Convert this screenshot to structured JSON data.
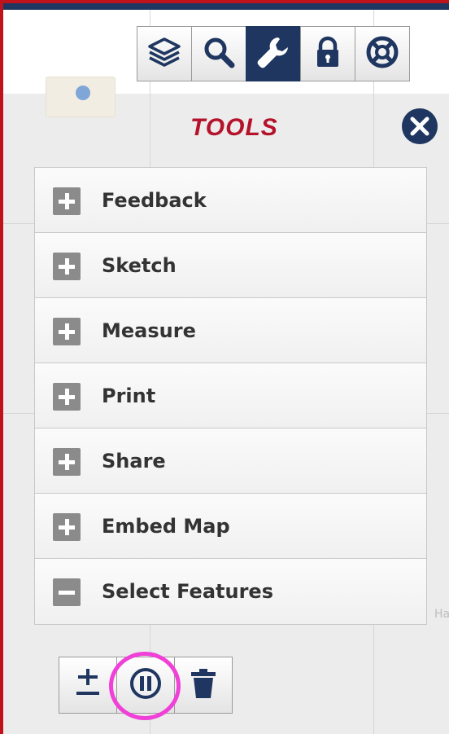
{
  "colors": {
    "accent_navy": "#1f3660",
    "title_red": "#b5132b",
    "frame_red": "#c0121b",
    "highlight_magenta": "#f040d8"
  },
  "map": {
    "partial_label": "Ha"
  },
  "toolbar": {
    "buttons": [
      {
        "icon": "layers-icon",
        "active": false
      },
      {
        "icon": "search-icon",
        "active": false
      },
      {
        "icon": "wrench-icon",
        "active": true
      },
      {
        "icon": "lock-icon",
        "active": false
      },
      {
        "icon": "lifebuoy-icon",
        "active": false
      }
    ]
  },
  "panel": {
    "title": "TOOLS",
    "close_icon": "close-icon",
    "items": [
      {
        "label": "Feedback",
        "state": "collapsed"
      },
      {
        "label": "Sketch",
        "state": "collapsed"
      },
      {
        "label": "Measure",
        "state": "collapsed"
      },
      {
        "label": "Print",
        "state": "collapsed"
      },
      {
        "label": "Share",
        "state": "collapsed"
      },
      {
        "label": "Embed Map",
        "state": "collapsed"
      },
      {
        "label": "Select Features",
        "state": "expanded"
      }
    ]
  },
  "select_features": {
    "buttons": [
      {
        "icon": "plus-minus-icon"
      },
      {
        "icon": "pause-icon",
        "highlighted": true
      },
      {
        "icon": "trash-icon"
      }
    ]
  }
}
